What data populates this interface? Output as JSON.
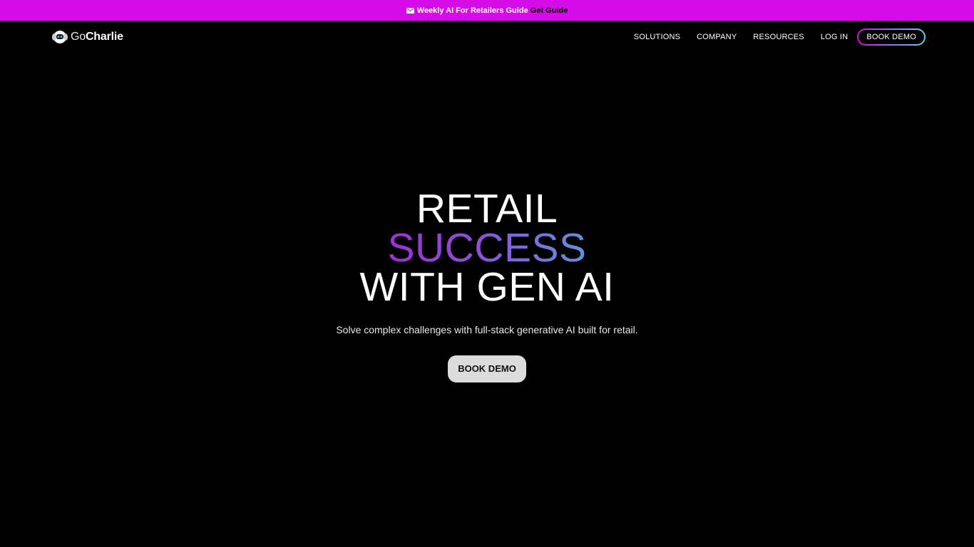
{
  "announcement": {
    "text": "Weekly AI For Retailers Guide",
    "link_label": "Get Guide",
    "icon": "mail-icon"
  },
  "header": {
    "logo": {
      "go": "Go",
      "charlie": "Charlie"
    },
    "nav": {
      "solutions": "SOLUTIONS",
      "company": "COMPANY",
      "resources": "RESOURCES",
      "login": "LOG IN",
      "book_demo": "BOOK DEMO"
    }
  },
  "hero": {
    "line1": "RETAIL",
    "line2": "SUCCESS",
    "line3": "WITH GEN AI",
    "subtitle": "Solve complex challenges with full-stack generative AI built for retail.",
    "cta": "BOOK DEMO"
  },
  "colors": {
    "announcement_bg": "#d50be8",
    "page_bg": "#000000",
    "gradient_start": "#9f2ed6",
    "gradient_end": "#5f92dc",
    "cta_bg": "#dcdcdc"
  }
}
